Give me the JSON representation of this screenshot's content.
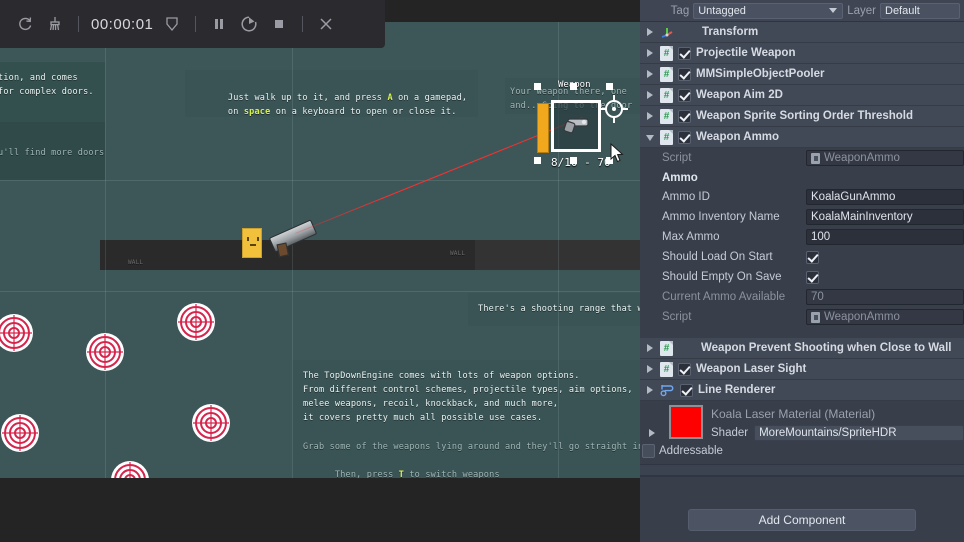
{
  "toolbar": {
    "icons": [
      "refresh-icon",
      "broom-icon"
    ],
    "time": "00:00:01",
    "shield_icon": "shield-icon",
    "pause_icon": "pause-icon",
    "step_icon": "step-icon",
    "stop_icon": "stop-icon",
    "close_icon": "close-icon"
  },
  "game": {
    "texts": {
      "door_left_1": "tion, and comes",
      "door_left_2": "for complex doors.",
      "door_left_3": "u'll find more doors",
      "interact_1_pre": "Just walk up to it, and press ",
      "interact_1_key": "A",
      "interact_1_post": " on a gamepad,",
      "interact_2_pre": "on ",
      "interact_2_key": "space",
      "interact_2_post": " on a keyboard to open or close it.",
      "weapon_hint_1": "Your weapon there, one",
      "weapon_hint_2": "and.. Going to the door",
      "shooting_range": "There's a shooting range that wa",
      "info_1": "The TopDownEngine comes with lots of weapon options.",
      "info_2": "From different control schemes, projectile types, aim options,",
      "info_3": "melee weapons, recoil, knockback, and much more,",
      "info_4": "it covers pretty much all possible use cases.",
      "info_5": "Grab some of the weapons lying around and they'll go straight in your",
      "info_6_pre": "Then, press ",
      "info_6_key": "T",
      "info_6_post": " to switch weapons",
      "wall_label": "WALL"
    },
    "hud": {
      "weapon_label": "Weapon",
      "ammo_readout": "8/10 - 70"
    },
    "colors": {
      "laser": "#ff2d2d",
      "highlight": "#d8f14a",
      "target": "#d6254d",
      "player": "#f2c13c"
    }
  },
  "inspector": {
    "tag_label": "Tag",
    "tag_value": "Untagged",
    "layer_label": "Layer",
    "layer_value": "Default",
    "components": [
      {
        "name": "Transform",
        "icon": "transform-icon",
        "has_checkbox": false,
        "checked": false,
        "expanded": false
      },
      {
        "name": "Projectile Weapon",
        "icon": "csharp-script-icon",
        "has_checkbox": true,
        "checked": true,
        "expanded": false
      },
      {
        "name": "MMSimpleObjectPooler",
        "icon": "csharp-script-icon",
        "has_checkbox": true,
        "checked": true,
        "expanded": false
      },
      {
        "name": "Weapon Aim 2D",
        "icon": "csharp-script-icon",
        "has_checkbox": true,
        "checked": true,
        "expanded": false
      },
      {
        "name": "Weapon Sprite Sorting Order Threshold",
        "icon": "csharp-script-icon",
        "has_checkbox": true,
        "checked": true,
        "expanded": false
      },
      {
        "name": "Weapon Ammo",
        "icon": "csharp-script-icon",
        "has_checkbox": true,
        "checked": true,
        "expanded": true
      }
    ],
    "weapon_ammo": {
      "script_label": "Script",
      "script_value": "WeaponAmmo",
      "section_title": "Ammo",
      "fields": [
        {
          "label": "Ammo ID",
          "value": "KoalaGunAmmo",
          "type": "text",
          "disabled": false
        },
        {
          "label": "Ammo Inventory Name",
          "value": "KoalaMainInventory",
          "type": "text",
          "disabled": false
        },
        {
          "label": "Max Ammo",
          "value": "100",
          "type": "text",
          "disabled": false
        },
        {
          "label": "Should Load On Start",
          "value": true,
          "type": "checkbox",
          "disabled": false
        },
        {
          "label": "Should Empty On Save",
          "value": true,
          "type": "checkbox",
          "disabled": false
        },
        {
          "label": "Current Ammo Available",
          "value": "70",
          "type": "text",
          "disabled": true
        }
      ],
      "script_bottom_label": "Script",
      "script_bottom_value": "WeaponAmmo"
    },
    "components_lower": [
      {
        "name": "Weapon Prevent Shooting when Close to Wall",
        "icon": "csharp-script-icon",
        "has_checkbox": false,
        "checked": false,
        "expanded": false
      },
      {
        "name": "Weapon Laser Sight",
        "icon": "csharp-script-icon",
        "has_checkbox": true,
        "checked": true,
        "expanded": false
      },
      {
        "name": "Line Renderer",
        "icon": "line-renderer-icon",
        "has_checkbox": true,
        "checked": true,
        "expanded": false
      }
    ],
    "material": {
      "title": "Koala Laser Material (Material)",
      "color": "#ff0000",
      "shader_label": "Shader",
      "shader_value": "MoreMountains/SpriteHDR",
      "addressable_label": "Addressable",
      "addressable_checked": false
    },
    "add_component_label": "Add Component"
  }
}
